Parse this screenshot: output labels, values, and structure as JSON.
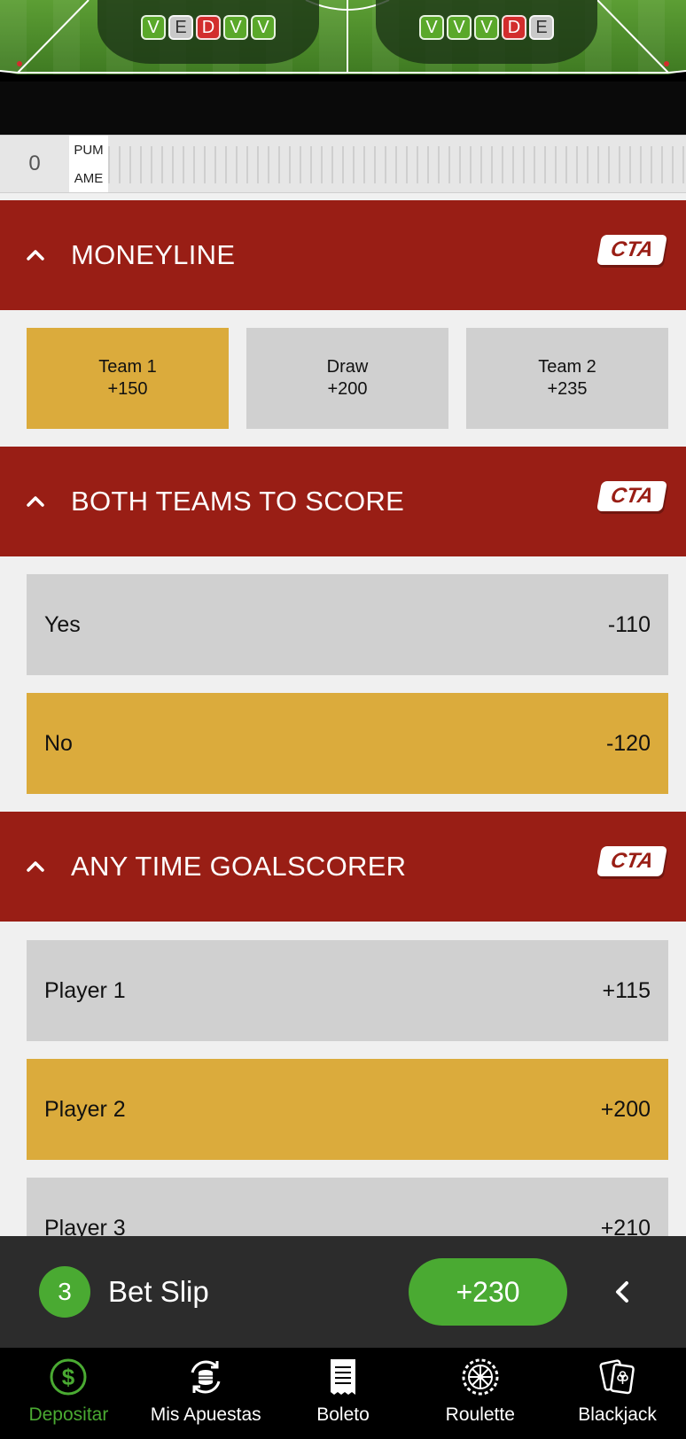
{
  "match_header": {
    "home_form": [
      "V",
      "E",
      "D",
      "V",
      "V"
    ],
    "away_form": [
      "V",
      "V",
      "V",
      "D",
      "E"
    ]
  },
  "score_strip": {
    "total": "0",
    "home_abbr": "PUM",
    "away_abbr": "AME"
  },
  "markets": {
    "moneyline": {
      "title": "MONEYLINE",
      "tag": "CTA",
      "options": [
        {
          "label": "Team 1",
          "odds": "+150",
          "selected": true
        },
        {
          "label": "Draw",
          "odds": "+200",
          "selected": false
        },
        {
          "label": "Team 2",
          "odds": "+235",
          "selected": false
        }
      ]
    },
    "btts": {
      "title": "BOTH TEAMS TO SCORE",
      "tag": "CTA",
      "options": [
        {
          "label": "Yes",
          "odds": "-110",
          "selected": false
        },
        {
          "label": "No",
          "odds": "-120",
          "selected": true
        }
      ]
    },
    "goalscorer": {
      "title": "ANY TIME GOALSCORER",
      "tag": "CTA",
      "options": [
        {
          "label": "Player 1",
          "odds": "+115",
          "selected": false
        },
        {
          "label": "Player 2",
          "odds": "+200",
          "selected": true
        },
        {
          "label": "Player 3",
          "odds": "+210",
          "selected": false
        }
      ]
    }
  },
  "bet_slip": {
    "count": "3",
    "label": "Bet Slip",
    "total_odds": "+230"
  },
  "bottom_nav": [
    {
      "label": "Depositar",
      "icon": "dollar-coin-icon",
      "active": true
    },
    {
      "label": "Mis Apuestas",
      "icon": "coins-refresh-icon",
      "active": false
    },
    {
      "label": "Boleto",
      "icon": "ticket-document-icon",
      "active": false
    },
    {
      "label": "Roulette",
      "icon": "roulette-wheel-icon",
      "active": false
    },
    {
      "label": "Blackjack",
      "icon": "playing-cards-icon",
      "active": false
    }
  ],
  "colors": {
    "market_header": "#991e15",
    "selected": "#dbab3c",
    "unselected": "#d0d0d0",
    "accent_green": "#4aaa32",
    "bet_slip_bar": "#2c2c2c"
  }
}
